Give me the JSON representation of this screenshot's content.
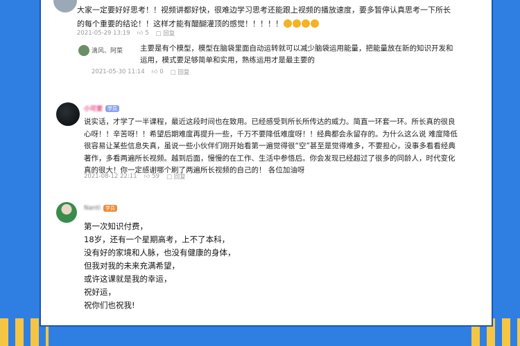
{
  "comment1": {
    "text": "大家一定要好好思考！！视频讲都好快，很难边学习思考还能跟上视频的播放速度，要多暂停认真思考一下所长的每个重要的结论！！这样才能有醍醐灌顶的感觉！！！！！",
    "date": "2021-05-29 13:19",
    "likes": "5",
    "reply_label": "回复"
  },
  "reply1": {
    "name": "滴风、阿菜",
    "text": "主要是有个模型，模型在脑袋里面自动运转就可以减少脑袋运用能量，把能量放在新的知识开发和运用，模式要足够简单和实用，熟练运用才是最主要的",
    "date": "2021-05-30 11:14",
    "likes": "0",
    "reply_label": "回复"
  },
  "comment2": {
    "name": "小可爱",
    "badge": "学员",
    "text": "说实话，才学了一半课程，最近这段时间也在致用。已经感受到所长所传达的威力。简直一环套一环。所长真的很良心呀！！辛苦呀！！希望后期难度再提升一些，千万不要降低难度呀！！经典都会永留存的。为什么这么说 难度降低很容易让某些信息失真，虽说一些小伙伴们刚开始看第一遍觉得很“空”甚至是觉得难多，不要担心，没事多看看经典著作，多看两遍所长视频。越到后面，慢慢的在工作、生活中参悟后。你会发现已经超过了很多的同龄人，时代变化真的很大！你一定感谢哪个刷了两遍所长视频的自己的！ 各位加油呀",
    "date": "2021-08-12 22:11",
    "likes": "59",
    "reply_label": "回复"
  },
  "comment3": {
    "name": "Nanti",
    "badge": "学员",
    "lines": [
      "第一次知识付费，",
      "18岁，还有一个星期高考，上不了本科，",
      "没有好的家境和人脉，也没有健康的身体，",
      "但我对我的未来充满希望，",
      "或许这课就是我的幸运，",
      "祝好运，",
      "祝你们也祝我!"
    ]
  }
}
